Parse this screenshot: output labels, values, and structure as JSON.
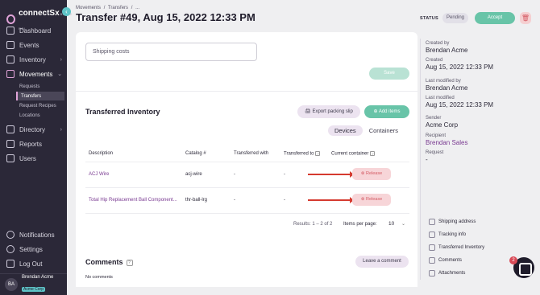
{
  "app": {
    "logo_text": "connectSx",
    "logo_sub": "BRAVE ROI"
  },
  "sidebar": {
    "items": [
      {
        "label": "Dashboard"
      },
      {
        "label": "Events"
      },
      {
        "label": "Inventory"
      },
      {
        "label": "Movements"
      },
      {
        "label": "Directory"
      },
      {
        "label": "Reports"
      },
      {
        "label": "Users"
      }
    ],
    "movements_sub": [
      {
        "label": "Requests"
      },
      {
        "label": "Transfers"
      },
      {
        "label": "Request Recipes"
      },
      {
        "label": "Locations"
      }
    ],
    "bottom": [
      {
        "label": "Notifications"
      },
      {
        "label": "Settings"
      },
      {
        "label": "Log Out"
      }
    ],
    "user": {
      "initials": "BA",
      "name": "Brendan Acme",
      "org": "Acme Corp"
    }
  },
  "header": {
    "breadcrumb": [
      "Movements",
      "/",
      "Transfers",
      "/",
      "..."
    ],
    "title": "Transfer #49, Aug 15, 2022 12:33 PM",
    "status_label": "STATUS",
    "status_value": "Pending",
    "accept_label": "Accept"
  },
  "form": {
    "shipping_placeholder": "Shipping costs",
    "save_label": "Save"
  },
  "inventory": {
    "title": "Transferred Inventory",
    "export_label": "Export packing slip",
    "add_label": "Add items",
    "tabs": [
      "Devices",
      "Containers"
    ],
    "columns": [
      "Description",
      "Catalog #",
      "Transferred with",
      "Transferred to",
      "Current container"
    ],
    "rows": [
      {
        "description": "ACJ Wire",
        "catalog": "acj-wire",
        "with": "-",
        "to": "-",
        "action": "Release"
      },
      {
        "description": "Total Hip Replacement Ball Component...",
        "catalog": "thr-ball-lrg",
        "with": "-",
        "to": "-",
        "action": "Release"
      }
    ],
    "results": "Results: 1 – 2 of 2",
    "per_page_label": "Items per page:",
    "per_page_value": "10"
  },
  "comments": {
    "title": "Comments",
    "leave_label": "Leave a comment",
    "empty": "No comments"
  },
  "details": {
    "created_by_label": "Created by",
    "created_by": "Brendan Acme",
    "created_label": "Created",
    "created": "Aug 15, 2022 12:33 PM",
    "modified_by_label": "Last modified by",
    "modified_by": "Brendan Acme",
    "modified_label": "Last modified",
    "modified": "Aug 15, 2022 12:33 PM",
    "sender_label": "Sender",
    "sender": "Acme Corp",
    "recipient_label": "Recipient",
    "recipient": "Brendan Sales",
    "request_label": "Request",
    "request": "-"
  },
  "side_links": [
    "Shipping address",
    "Tracking info",
    "Transferred Inventory",
    "Comments",
    "Attachments"
  ],
  "chat": {
    "badge": "2"
  }
}
